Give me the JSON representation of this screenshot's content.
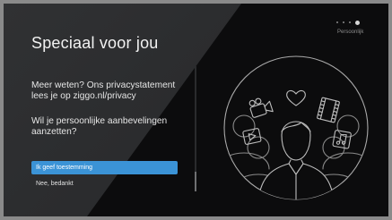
{
  "onboarding": {
    "title": "Speciaal voor jou",
    "info_text": "Meer weten? Ons privacystatement lees je op ziggo.nl/privacy",
    "question": "Wil je persoonlijke aanbevelingen aanzetten?",
    "accept_label": "Ik geef toestemming",
    "decline_label": "Nee, bedankt",
    "step_label": "Persoonlijk",
    "steps_total": 4,
    "step_current": 4
  },
  "colors": {
    "accent": "#3b93d6",
    "panel": "#2b2c2e",
    "background": "#0c0c0d"
  }
}
